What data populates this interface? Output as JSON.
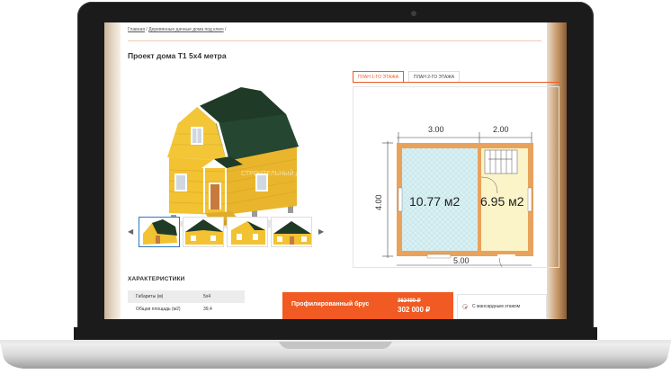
{
  "breadcrumb": [
    "Главная",
    "Деревянные дачные дома под ключ"
  ],
  "page_title": "Проект дома Т1 5х4 метра",
  "watermark": "СТРОИТЕЛЬНЫЙ ДОМ РФ",
  "gallery": {
    "thumb_count": 4
  },
  "tabs": [
    {
      "label": "ПЛАН 1-ГО ЭТАЖА",
      "active": true
    },
    {
      "label": "ПЛАН 2-ГО ЭТАЖА",
      "active": false
    }
  ],
  "plan": {
    "top_dims": [
      "3.00",
      "2.00"
    ],
    "bottom_dim": "5.00",
    "side_dim": "4.00",
    "rooms": [
      {
        "area": "10.77 м2"
      },
      {
        "area": "6.95 м2"
      }
    ]
  },
  "characteristics": {
    "heading": "ХАРАКТЕРИСТИКИ",
    "rows": [
      {
        "key": "Габариты (м)",
        "value": "5х4"
      },
      {
        "key": "Общая площадь (м2)",
        "value": "39,4"
      }
    ]
  },
  "price": {
    "label": "Профилированный брус",
    "old": "362400 ₽",
    "new": "302 000 ₽"
  },
  "option": {
    "label": "С мансардным этажом"
  },
  "colors": {
    "accent": "#f15a22",
    "link": "#2a78c4"
  }
}
